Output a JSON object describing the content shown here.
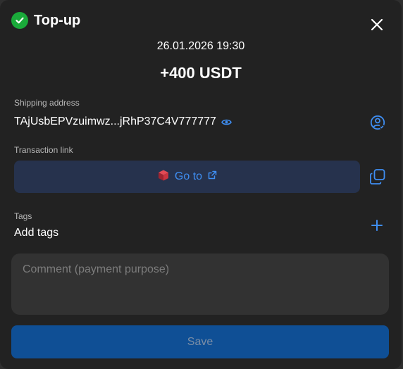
{
  "header": {
    "title": "Top-up",
    "status_icon": "check-circle-icon",
    "close_icon": "close-icon"
  },
  "transaction": {
    "datetime": "26.01.2026 19:30",
    "amount": "+400 USDT"
  },
  "shipping": {
    "label": "Shipping address",
    "address": "TAjUsbEPVzuimwz...jRhP37C4V777777",
    "reveal_icon": "eye-icon",
    "action_icon": "user-check-icon"
  },
  "link": {
    "label": "Transaction link",
    "button_label": "Go to",
    "block_icon": "cube-icon",
    "external_icon": "external-link-icon",
    "copy_icon": "copy-icon"
  },
  "tags": {
    "label": "Tags",
    "value": "Add tags",
    "add_icon": "plus-icon"
  },
  "comment": {
    "placeholder": "Comment (payment purpose)",
    "value": ""
  },
  "actions": {
    "save_label": "Save"
  },
  "colors": {
    "background": "#222222",
    "accent": "#3f8ef2",
    "success": "#1aaa3a",
    "link_button_bg": "#26324d",
    "save_button_bg": "#0f4f95",
    "muted_text": "#b8b8b8"
  }
}
